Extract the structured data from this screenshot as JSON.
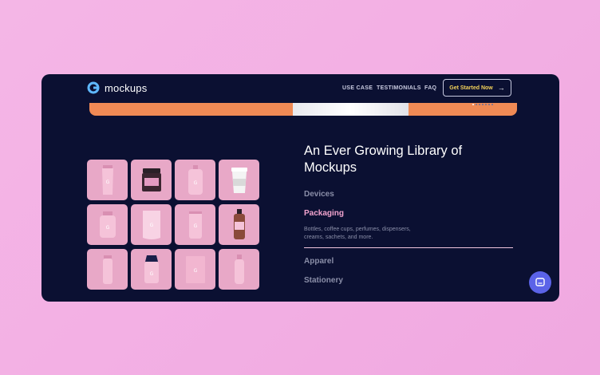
{
  "header": {
    "brand": "mockups",
    "nav": [
      "USE CASE",
      "TESTIMONIALS",
      "FAQ"
    ],
    "cta_label": "Get Started Now"
  },
  "colors": {
    "background": "#0b1032",
    "accent_pink": "#f2a4cf",
    "hero_orange": "#f08a55",
    "cta_yellow": "#f3d25a",
    "chat_button": "#5b63e8"
  },
  "section": {
    "heading_line1": "An Ever Growing Library of",
    "heading_line2": "Mockups",
    "categories": [
      {
        "label": "Devices",
        "active": false
      },
      {
        "label": "Packaging",
        "active": true
      },
      {
        "label": "Apparel",
        "active": false
      },
      {
        "label": "Stationery",
        "active": false
      }
    ],
    "active_description_line1": "Bottles, coffee cups, perfumes, dispensers,",
    "active_description_line2": "creams, sachets, and more."
  },
  "products": [
    "tube-icon",
    "jar-icon",
    "spray-bottle-icon",
    "coffee-cup-icon",
    "pill-bottle-icon",
    "pouch-icon",
    "can-icon",
    "dispenser-icon",
    "slim-bottle-icon",
    "shaker-icon",
    "box-icon",
    "perfume-bottle-icon"
  ],
  "chat_icon": "chat-icon"
}
